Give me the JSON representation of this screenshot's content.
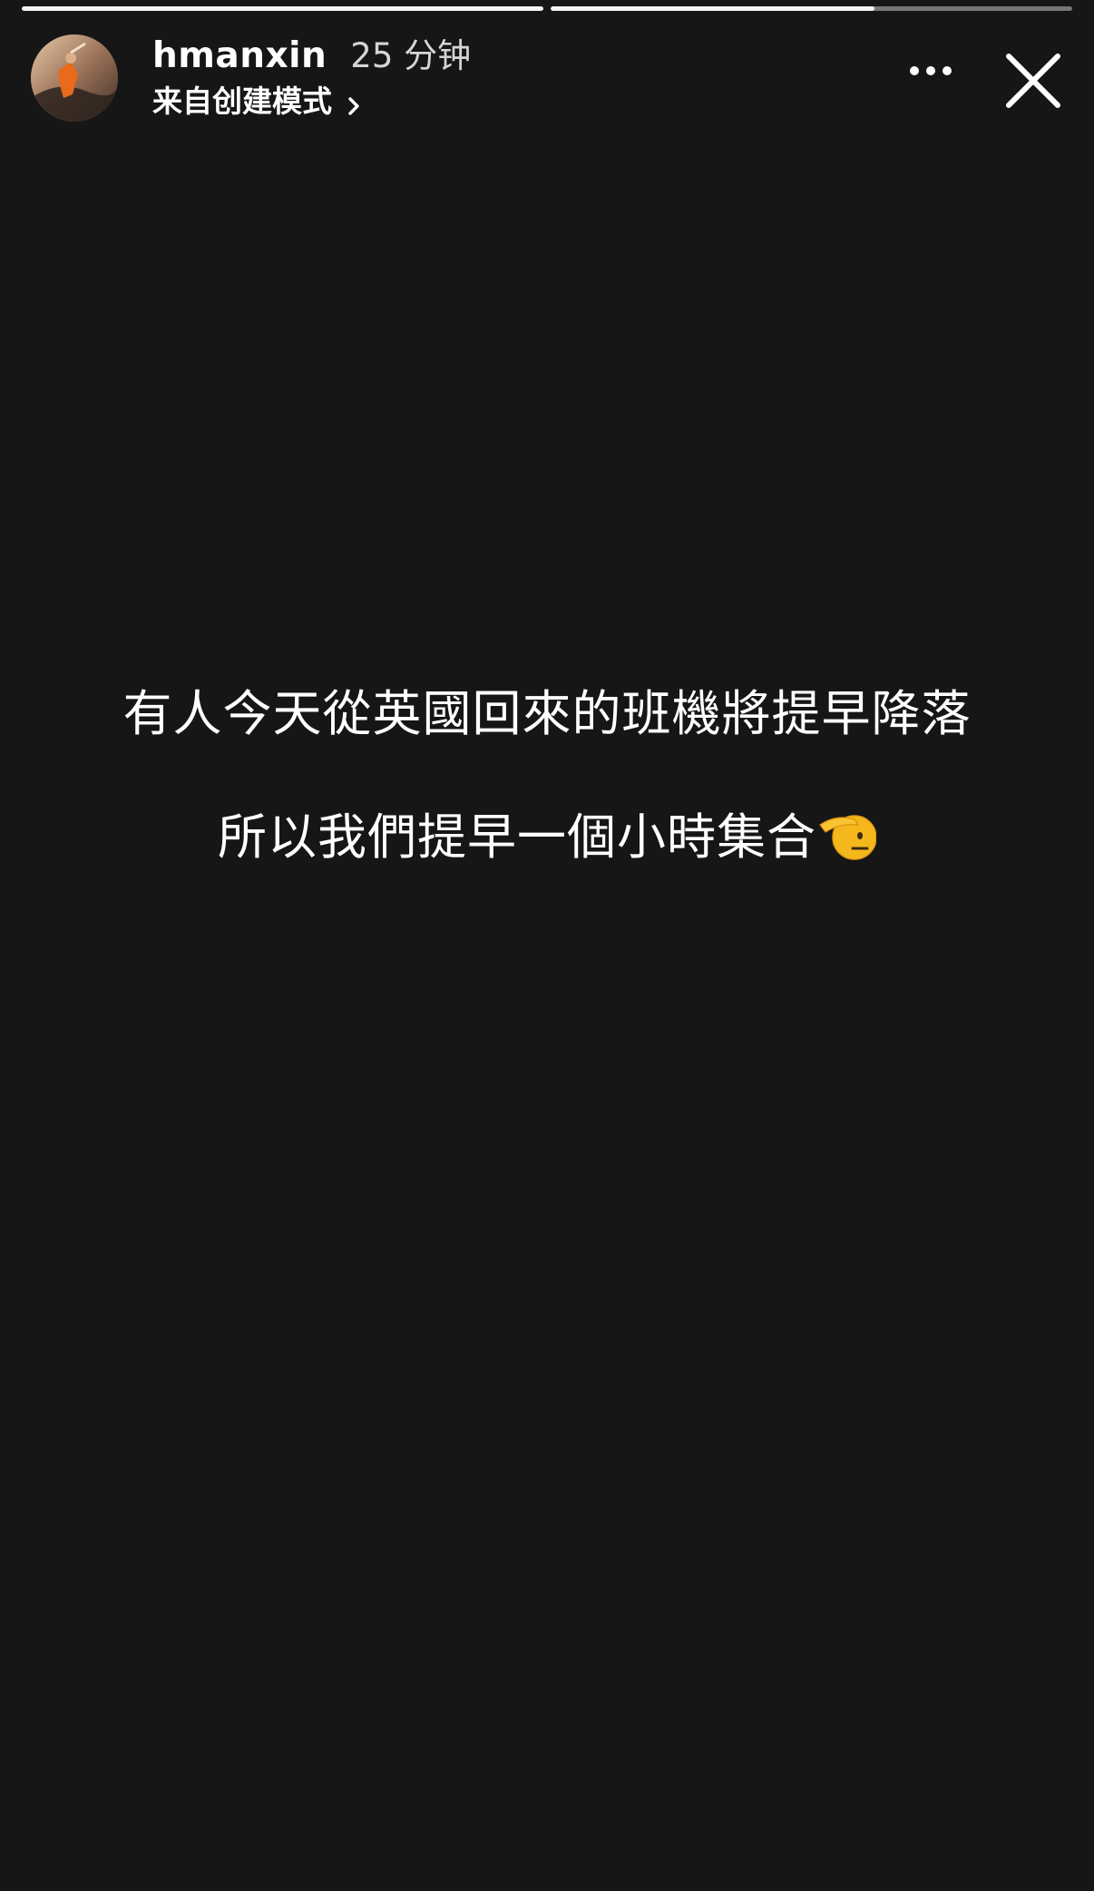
{
  "story": {
    "progress": [
      {
        "fraction": 1.0
      },
      {
        "fraction": 0.62
      }
    ]
  },
  "header": {
    "avatar_icon": "avatar-photo",
    "username": "hmanxin",
    "time_ago": "25 分钟",
    "source_label": "来自创建模式",
    "source_chevron_icon": "chevron-right-icon",
    "more_icon": "more-horizontal-icon",
    "close_icon": "close-icon"
  },
  "content": {
    "line1": "有人今天從英國回來的班機將提早降落",
    "line2": "所以我們提早一個小時集合",
    "emoji_icon": "saluting-face-emoji"
  },
  "colors": {
    "background": "#161616",
    "text": "#ffffff",
    "progress_track": "rgba(255,255,255,0.42)",
    "progress_fill": "#f2f2f2",
    "emoji": "#f5b81c"
  }
}
